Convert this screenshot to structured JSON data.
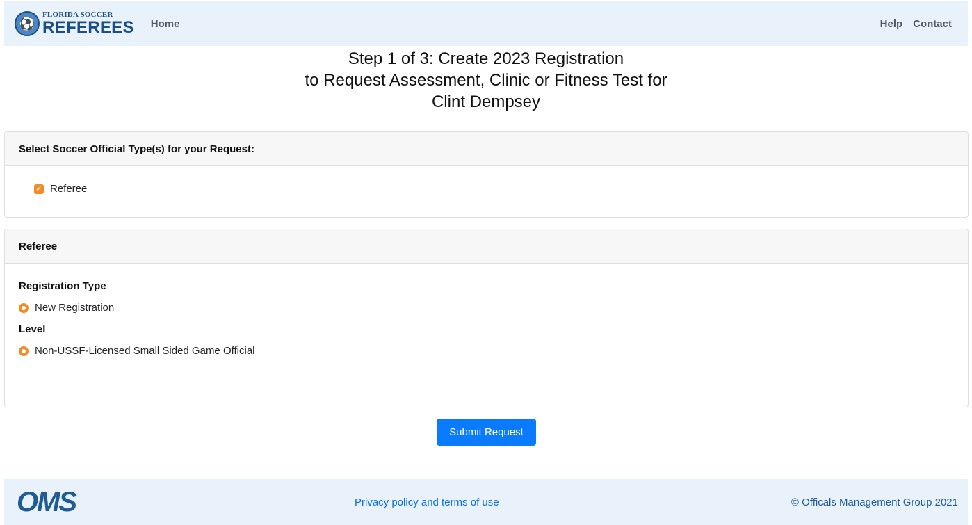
{
  "nav": {
    "logo_top": "FLORIDA SOCCER",
    "logo_bottom": "REFEREES",
    "home": "Home",
    "help": "Help",
    "contact": "Contact"
  },
  "title": {
    "line1": "Step 1 of 3: Create 2023 Registration",
    "line2": "to Request Assessment, Clinic or Fitness Test for",
    "line3": "Clint Dempsey"
  },
  "official_type_card": {
    "header": "Select Soccer Official Type(s) for your Request:",
    "options": [
      {
        "label": "Referee",
        "checked": true
      }
    ]
  },
  "referee_card": {
    "header": "Referee",
    "registration_type_label": "Registration Type",
    "registration_type_option": "New Registration",
    "level_label": "Level",
    "level_option": "Non-USSF-Licensed Small Sided Game Official"
  },
  "submit_label": "Submit Request",
  "footer": {
    "logo": "OMS",
    "privacy_link": "Privacy policy and terms of use",
    "copyright": "© Officals Management Group 2021"
  },
  "colors": {
    "accent_orange": "#f28c28",
    "primary_blue": "#0a7bff",
    "nav_bg": "#e9f2fb"
  }
}
